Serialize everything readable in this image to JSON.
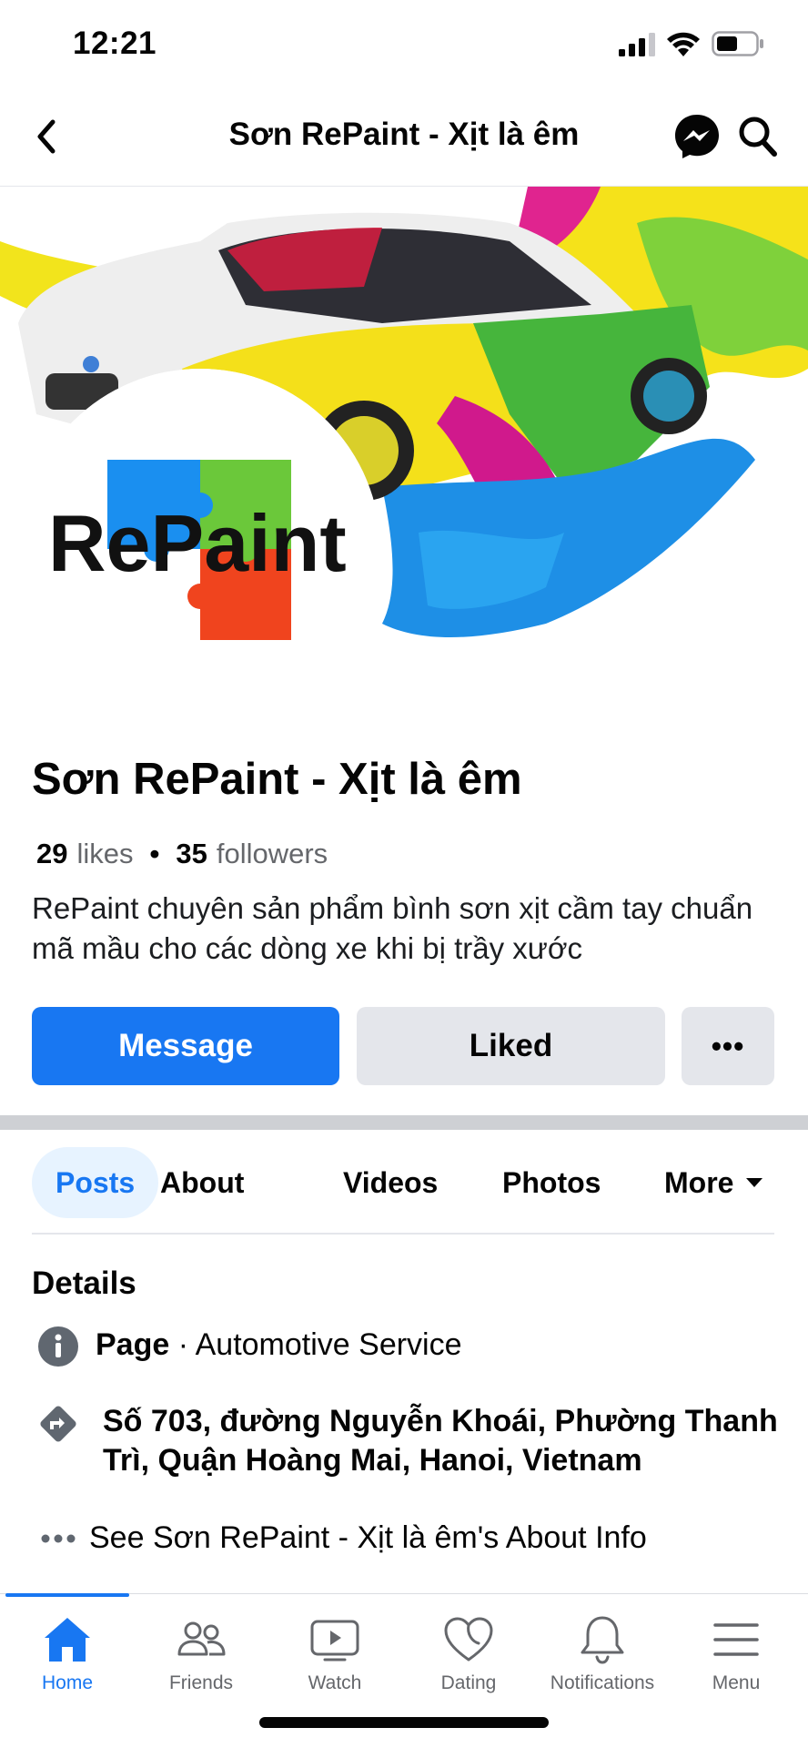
{
  "status_bar": {
    "time": "12:21"
  },
  "header": {
    "title": "Sơn RePaint - Xịt là êm"
  },
  "cover": {
    "logo_text": "RePaint"
  },
  "page": {
    "name": "Sơn RePaint - Xịt là êm",
    "likes_count": "29",
    "likes_label": "likes",
    "followers_count": "35",
    "followers_label": "followers",
    "separator": "•",
    "bio": "RePaint chuyên sản phẩm bình sơn xịt cầm tay chuẩn mã mầu cho các dòng xe khi bị trầy xước"
  },
  "actions": {
    "message": "Message",
    "liked": "Liked",
    "more": "•••"
  },
  "tabs": [
    {
      "label": "Posts",
      "active": true
    },
    {
      "label": "About"
    },
    {
      "label": "Videos"
    },
    {
      "label": "Photos"
    },
    {
      "label": "More"
    }
  ],
  "details": {
    "title": "Details",
    "category_type": "Page",
    "category_separator": " · ",
    "category": "Automotive Service",
    "address": "Số 703, đường Nguyễn Khoái, Phường Thanh Trì, Quận Hoàng Mai, Hanoi, Vietnam",
    "about_link": "See Sơn RePaint - Xịt là êm's About Info"
  },
  "bottom_nav": [
    {
      "label": "Home",
      "icon": "home-icon",
      "active": true
    },
    {
      "label": "Friends",
      "icon": "friends-icon"
    },
    {
      "label": "Watch",
      "icon": "watch-icon"
    },
    {
      "label": "Dating",
      "icon": "dating-icon"
    },
    {
      "label": "Notifications",
      "icon": "bell-icon"
    },
    {
      "label": "Menu",
      "icon": "menu-icon"
    }
  ],
  "colors": {
    "accent": "#1877f2",
    "secondary_bg": "#e4e6eb",
    "muted_text": "#65676b"
  }
}
